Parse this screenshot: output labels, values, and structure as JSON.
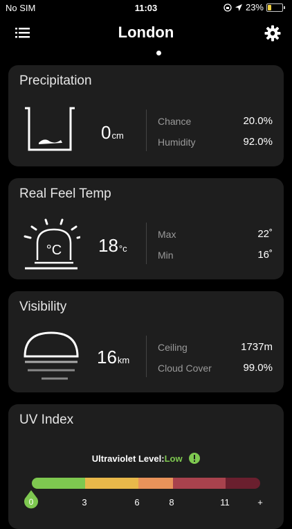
{
  "status": {
    "carrier": "No SIM",
    "time": "11:03",
    "battery": "23%"
  },
  "header": {
    "title": "London"
  },
  "precipitation": {
    "title": "Precipitation",
    "value": "0",
    "unit": "cm",
    "chance_label": "Chance",
    "chance_value": "20.0%",
    "humidity_label": "Humidity",
    "humidity_value": "92.0%"
  },
  "real_feel": {
    "title": "Real Feel Temp",
    "value": "18",
    "unit": "°c",
    "icon_text": "°C",
    "max_label": "Max",
    "max_value": "22˚",
    "min_label": "Min",
    "min_value": "16˚"
  },
  "visibility": {
    "title": "Visibility",
    "value": "16",
    "unit": "km",
    "ceiling_label": "Ceiling",
    "ceiling_value": "1737m",
    "cloud_label": "Cloud Cover",
    "cloud_value": "99.0%"
  },
  "uv": {
    "title": "UV Index",
    "level_label": "Ultraviolet Level:",
    "level_value": "Low",
    "current_index": "0",
    "scale": [
      "3",
      "6",
      "8",
      "11",
      "+"
    ],
    "colors": {
      "low": "#7ec850",
      "moderate": "#e8b84a",
      "high": "#e8935a",
      "very_high": "#a8424d",
      "extreme": "#6a1f2e",
      "icon": "#7ec850"
    }
  }
}
